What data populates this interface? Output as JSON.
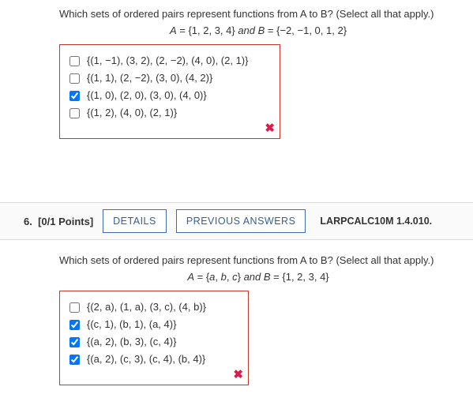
{
  "q1": {
    "prompt": "Which sets of ordered pairs represent functions from A to B? (Select all that apply.)",
    "sets_html": "A = {1, 2, 3, 4} and B = {−2, −1, 0, 1, 2}",
    "options": [
      {
        "label": "{(1, −1), (3, 2), (2, −2), (4, 0), (2, 1)}",
        "checked": false
      },
      {
        "label": "{(1, 1), (2, −2), (3, 0), (4, 2)}",
        "checked": false
      },
      {
        "label": "{(1, 0), (2, 0), (3, 0), (4, 0)}",
        "checked": true
      },
      {
        "label": "{(1, 2), (4, 0), (2, 1)}",
        "checked": false
      }
    ],
    "mark": "✖"
  },
  "header": {
    "number": "6.",
    "points": "[0/1 Points]",
    "details": "DETAILS",
    "previous": "PREVIOUS ANSWERS",
    "ref": "LARPCALC10M 1.4.010."
  },
  "q2": {
    "prompt": "Which sets of ordered pairs represent functions from A to B? (Select all that apply.)",
    "sets_html": "A = {a, b, c} and B = {1, 2, 3, 4}",
    "options": [
      {
        "label": "{(2, a), (1, a), (3, c), (4, b)}",
        "checked": false
      },
      {
        "label": "{(c, 1), (b, 1), (a, 4)}",
        "checked": true
      },
      {
        "label": "{(a, 2), (b, 3), (c, 4)}",
        "checked": true
      },
      {
        "label": "{(a, 2), (c, 3), (c, 4), (b, 4)}",
        "checked": true
      }
    ],
    "mark": "✖"
  }
}
